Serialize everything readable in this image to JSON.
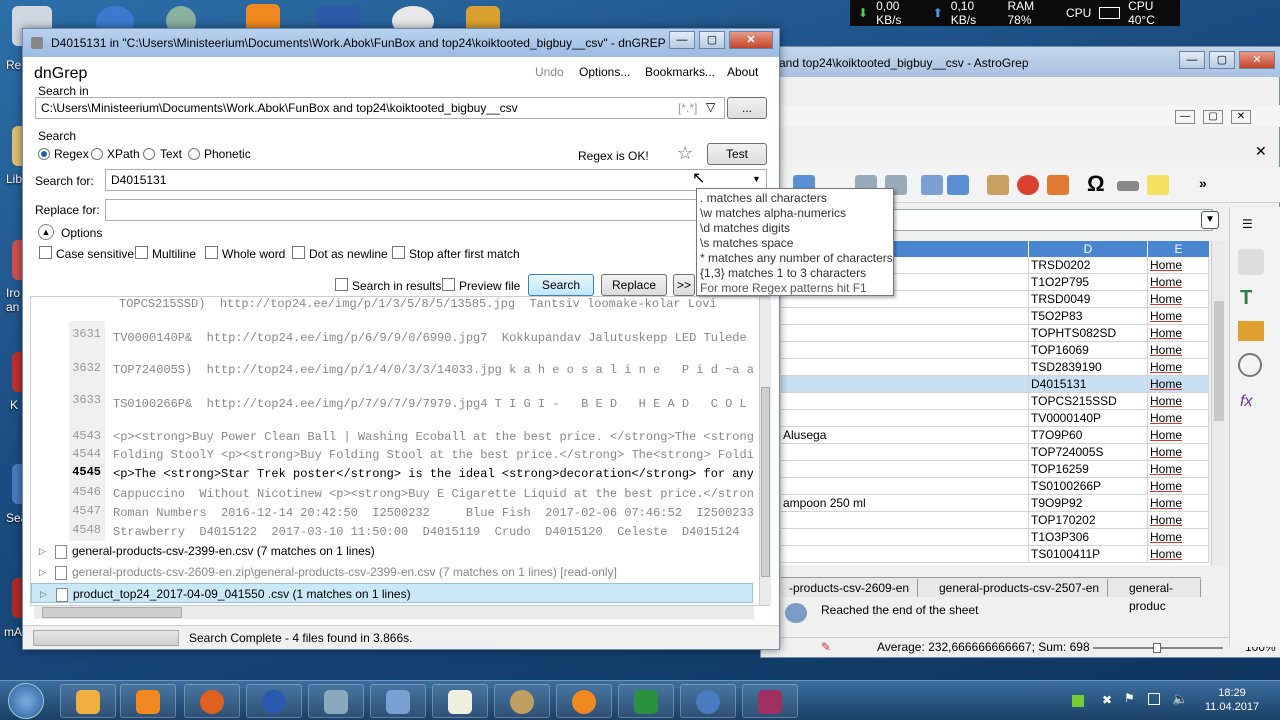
{
  "netmeter": {
    "down": "0,00 KB/s",
    "up": "0,10 KB/s",
    "ram": "RAM 78%",
    "cpu": "CPU",
    "cputemp": "CPU 40°C"
  },
  "desktop_labels": [
    "Re",
    "Lib",
    "Iro",
    "an",
    "K",
    "Sea",
    "mA"
  ],
  "astrogrep": {
    "title": "and top24\\koiktooted_bigbuy__csv - AstroGrep",
    "columns": [
      "D",
      "E"
    ],
    "rows": [
      {
        "b": "",
        "d": "TRSD0202",
        "e": "Home"
      },
      {
        "b": "",
        "d": "T1O2P795",
        "e": "Home"
      },
      {
        "b": "",
        "d": "TRSD0049",
        "e": "Home"
      },
      {
        "b": "",
        "d": "T5O2P83",
        "e": "Home"
      },
      {
        "b": "",
        "d": "TOPHTS082SD",
        "e": "Home"
      },
      {
        "b": "",
        "d": "TOP16069",
        "e": "Home"
      },
      {
        "b": "",
        "d": "TSD2839190",
        "e": "Home"
      },
      {
        "b": "",
        "d": "D4015131",
        "e": "Home"
      },
      {
        "b": "",
        "d": "TOPCS215SSD",
        "e": "Home"
      },
      {
        "b": "",
        "d": "TV0000140P",
        "e": "Home"
      },
      {
        "b": "Alusega",
        "d": "T7O9P60",
        "e": "Home"
      },
      {
        "b": "",
        "d": "TOP724005S",
        "e": "Home"
      },
      {
        "b": "",
        "d": "TOP16259",
        "e": "Home"
      },
      {
        "b": "",
        "d": "TS0100266P",
        "e": "Home"
      },
      {
        "b": "ampoon 250 ml",
        "d": "T9O9P92",
        "e": "Home"
      },
      {
        "b": "",
        "d": "TOP170202",
        "e": "Home"
      },
      {
        "b": "",
        "d": "T1O3P306",
        "e": "Home"
      },
      {
        "b": "",
        "d": "TS0100411P",
        "e": "Home"
      }
    ],
    "sheet_tabs": [
      "-products-csv-2609-en",
      "general-products-csv-2507-en",
      "general-produc"
    ],
    "status_message": "Reached the end of the sheet",
    "statusbar": "Average: 232,666666666667; Sum: 698",
    "zoom": "100%"
  },
  "dngrep": {
    "title": "D4015131 in \"C:\\Users\\Ministeerium\\Documents\\Work.Abok\\FunBox and top24\\koiktooted_bigbuy__csv\" - dnGREP",
    "app_name": "dnGrep",
    "menu": {
      "undo": "Undo",
      "options": "Options...",
      "bookmarks": "Bookmarks...",
      "about": "About"
    },
    "search_in_label": "Search in",
    "search_in_path": "C:\\Users\\Ministeerium\\Documents\\Work.Abok\\FunBox and top24\\koiktooted_bigbuy__csv",
    "filter_hint": "[*.*]",
    "browse_label": "...",
    "search_label": "Search",
    "modes": [
      "Regex",
      "XPath",
      "Text",
      "Phonetic"
    ],
    "regex_status": "Regex is OK!",
    "test_label": "Test",
    "search_for_label": "Search for:",
    "search_for_value": "D4015131",
    "replace_for_label": "Replace for:",
    "replace_for_value": "",
    "options_label": "Options",
    "checkboxes": [
      "Case sensitive",
      "Multiline",
      "Whole word",
      "Dot as newline",
      "Stop after first match"
    ],
    "search_in_results": "Search in results",
    "preview_file": "Preview file",
    "search_button": "Search",
    "replace_button": "Replace",
    "more_button": ">>",
    "tooltip": [
      ". matches all characters",
      "\\w matches alpha-numerics",
      "\\d matches digits",
      "\\s matches space",
      "* matches any number of characters",
      "{1,3} matches 1 to 3 characters",
      "For more Regex patterns hit F1"
    ],
    "preview_top": "TOPCS215SSD)  http://top24.ee/img/p/1/3/5/8/5/13585.jpg  Tantsiv loomake-kolar Lovi",
    "preview_lines": [
      {
        "n": "3631",
        "t": "TV0000140P&  http://top24.ee/img/p/6/9/9/0/6990.jpg7  Kokkupandav Jalutuskepp LED Tulede ja"
      },
      {
        "n": "3632",
        "t": "TOP724005S)  http://top24.ee/img/p/1/4/0/3/3/14033.jpg k a h e o s a l i n e   P i d ~a a m"
      },
      {
        "n": "3633",
        "t": "TS0100266P&  http://top24.ee/img/p/7/9/7/9/7979.jpg4 T I G I -   B E D   H E A D   C O L O U"
      }
    ],
    "match_lines": [
      {
        "n": "4543",
        "t": "<p><strong>Buy Power Clean Ball | Washing Ecoball at the best price. </strong>The <strong>wa"
      },
      {
        "n": "4544",
        "t": "Folding StoolY <p><strong>Buy Folding Stool at the best price.</strong> The<strong> Folding"
      },
      {
        "n": "4545",
        "t": "<p>The <strong>Star Trek poster</strong> is the ideal <strong>decoration</strong> for anyone"
      },
      {
        "n": "4546",
        "t": "Cappuccino  Without Nicotinew <p><strong>Buy E Cigarette Liquid at the best price.</strong>"
      },
      {
        "n": "4547",
        "t": "Roman Numbers  2016-12-14 20:42:50  I2500232     Blue Fish  2017-02-06 07:46:52  I2500233  H"
      },
      {
        "n": "4548",
        "t": "Strawberry  D4015122  2017-03-10 11:50:00  D4015119  Crudo  D4015120  Celeste  D4015124   Ch"
      }
    ],
    "files": [
      "general-products-csv-2399-en.csv (7 matches on 1 lines)",
      "general-products-csv-2609-en.zip\\general-products-csv-2399-en.csv (7 matches on 1 lines) [read-only]",
      "product_top24_2017-04-09_041550 .csv (1 matches on 1 lines)"
    ],
    "status": "Search Complete - 4 files found in 3.866s."
  },
  "clock": {
    "time": "18:29",
    "date": "11.04.2017"
  }
}
